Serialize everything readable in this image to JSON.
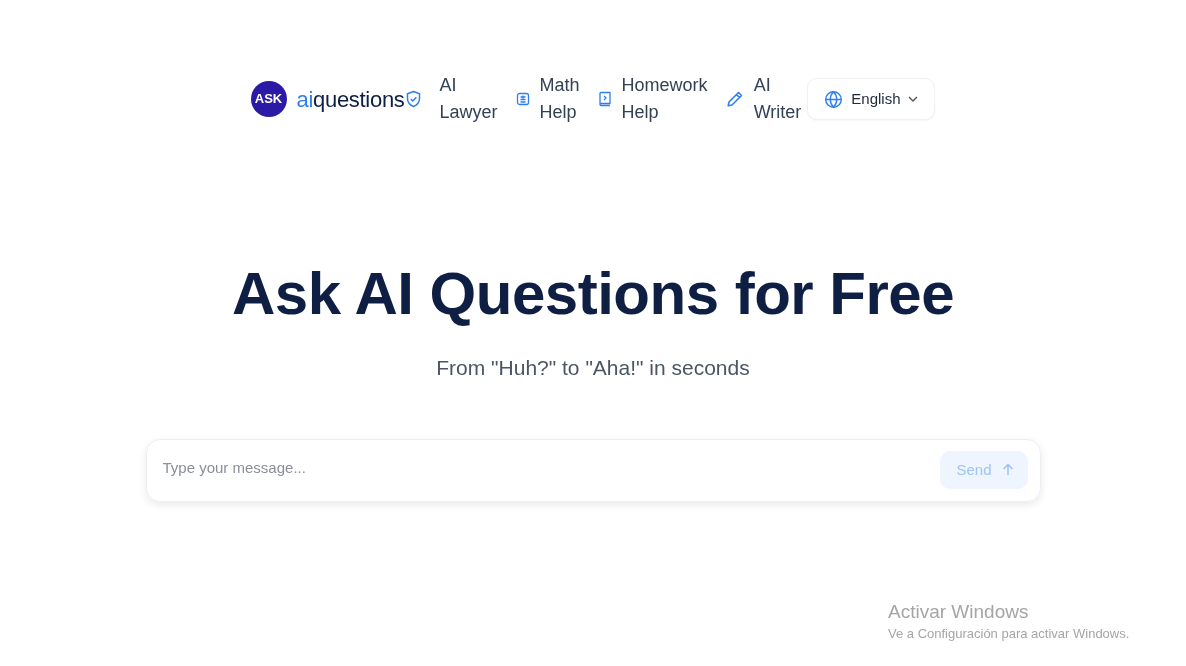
{
  "logo": {
    "badge": "ASK",
    "accent": "ai",
    "name": "questions"
  },
  "nav": [
    {
      "label": "AI Lawyer",
      "kind": "plain"
    },
    {
      "label": "Math Help",
      "kind": "calculator"
    },
    {
      "label": "Homework Help",
      "kind": "book"
    },
    {
      "label": "AI Writer",
      "kind": "pencil"
    }
  ],
  "language": {
    "label": "English"
  },
  "hero": {
    "title": "Ask AI Questions for Free",
    "subtitle": "From \"Huh?\" to \"Aha!\" in seconds"
  },
  "composer": {
    "placeholder": "Type your message...",
    "send": {
      "label": "Send",
      "disabled": true
    }
  },
  "os_overlay": {
    "title": "Activar Windows",
    "subtitle": "Ve a Configuración para activar Windows."
  }
}
